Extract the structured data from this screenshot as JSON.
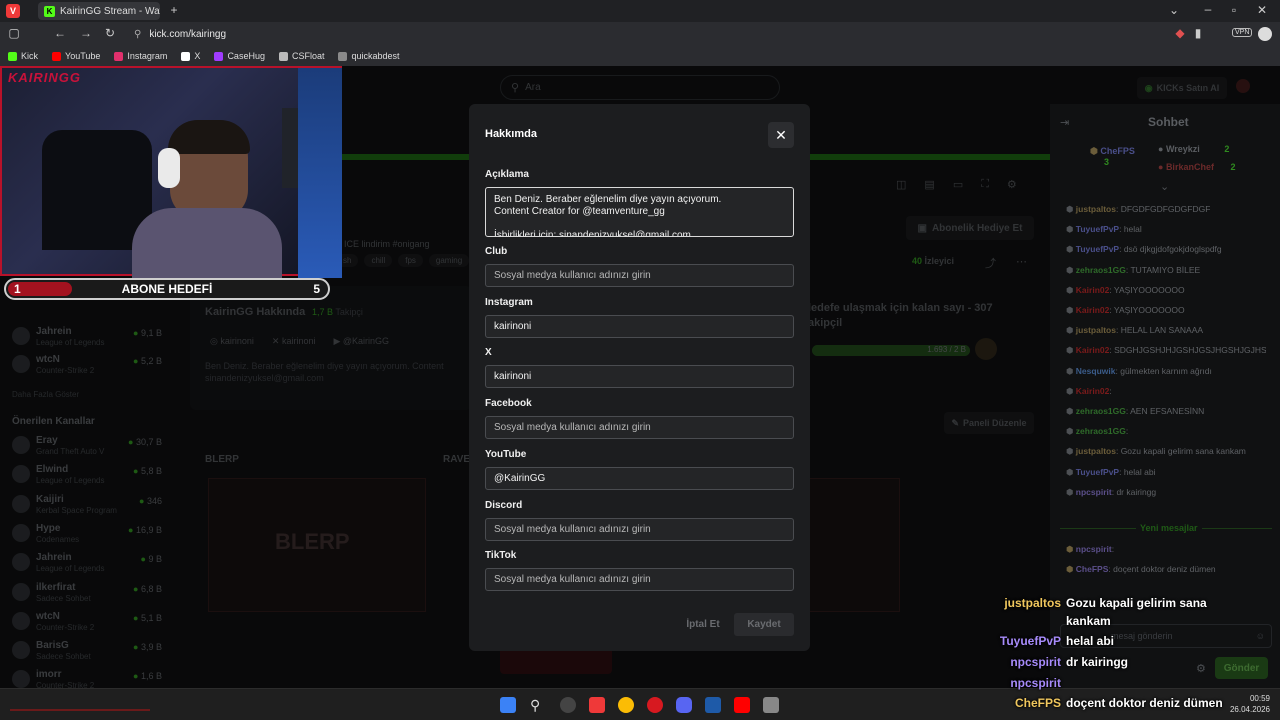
{
  "browser": {
    "tab_title": "KairinGG Stream - Watch Li",
    "url": "kick.com/kairingg",
    "bookmarks": [
      {
        "label": "Kick",
        "color": "#53fc18"
      },
      {
        "label": "YouTube",
        "color": "#ff0000"
      },
      {
        "label": "Instagram",
        "color": "#e1306c"
      },
      {
        "label": "X",
        "color": "#ffffff"
      },
      {
        "label": "CaseHug",
        "color": "#a03cff"
      },
      {
        "label": "CSFloat",
        "color": "#bbbbbb"
      },
      {
        "label": "quickabdest",
        "color": "#8a8a8a"
      }
    ]
  },
  "header": {
    "search_placeholder": "Ara",
    "buy_kicks": "KICKs Satın Al"
  },
  "stream": {
    "title_snippet": "ICE lindirim #onigang",
    "tags": [
      "sh",
      "chill",
      "fps",
      "gaming"
    ],
    "gift_sub_button": "Abonelik Hediye Et",
    "viewers": "40",
    "viewers_label": "İzleyici",
    "goal_text": "ledefe ulaşmak için kalan sayı - 307",
    "goal_text2": "akipçil",
    "goal_progress": "1.693 / 2 B",
    "about_title": "KairinGG Hakkında",
    "followers": "1,7 B",
    "followers_label": "Takipçi",
    "social_ig": "kairinoni",
    "social_x": "kairinoni",
    "social_yt": "@KairinGG",
    "bio_line1": "Ben Deniz. Beraber eğlenelim diye yayın açıyorum. Content",
    "bio_line2": "sinandenizyuksel@gmail.com",
    "edit_panel": "Paneli Düzenle",
    "panel_left": "BLERP",
    "panel_mid": "RAVE"
  },
  "sidebar": {
    "followed": [
      {
        "name": "Jahrein",
        "sub": "League of Legends",
        "val": "9,1 B"
      },
      {
        "name": "wtcN",
        "sub": "Counter-Strike 2",
        "val": "5,2 B"
      }
    ],
    "show_more": "Daha Fazla Göster",
    "recommended_title": "Önerilen Kanallar",
    "recommended": [
      {
        "name": "Eray",
        "sub": "Grand Theft Auto V",
        "val": "30,7 B"
      },
      {
        "name": "Elwind",
        "sub": "League of Legends",
        "val": "5,8 B"
      },
      {
        "name": "Kaijiri",
        "sub": "Kerbal Space Program",
        "val": "346"
      },
      {
        "name": "Hype",
        "sub": "Codenames",
        "val": "16,9 B"
      },
      {
        "name": "Jahrein",
        "sub": "League of Legends",
        "val": "9 B"
      },
      {
        "name": "ilkerfirat",
        "sub": "Sadece Sohbet",
        "val": "6,8 B"
      },
      {
        "name": "wtcN",
        "sub": "Counter-Strike 2",
        "val": "5,1 B"
      },
      {
        "name": "BarisG",
        "sub": "Sadece Sohbet",
        "val": "3,9 B"
      },
      {
        "name": "imorr",
        "sub": "Counter-Strike 2",
        "val": "1,6 B"
      }
    ]
  },
  "overlay": {
    "logo": "KAIRINGG",
    "sub_goal_label": "ABONE HEDEFİ",
    "sub_goal_current": "1",
    "sub_goal_target": "5",
    "sub_goal_fraction": 0.2
  },
  "modal": {
    "title": "Hakkımda",
    "description_label": "Açıklama",
    "description_value": "Ben Deniz. Beraber eğlenelim diye yayın açıyorum.\nContent Creator for @teamventure_gg\n\nİşbirlikleri için: sinandenizyuksel@gmail.com",
    "fields": [
      {
        "label": "Club",
        "value": "",
        "placeholder": "Sosyal medya kullanıcı adınızı girin"
      },
      {
        "label": "Instagram",
        "value": "kairinoni",
        "placeholder": ""
      },
      {
        "label": "X",
        "value": "kairinoni",
        "placeholder": ""
      },
      {
        "label": "Facebook",
        "value": "",
        "placeholder": "Sosyal medya kullanıcı adınızı girin"
      },
      {
        "label": "YouTube",
        "value": "@KairinGG",
        "placeholder": ""
      },
      {
        "label": "Discord",
        "value": "",
        "placeholder": "Sosyal medya kullanıcı adınızı girin"
      },
      {
        "label": "TikTok",
        "value": "",
        "placeholder": "Sosyal medya kullanıcı adınızı girin"
      }
    ],
    "cancel_label": "İptal Et",
    "save_label": "Kaydet"
  },
  "chat": {
    "title": "Sohbet",
    "top1": "CheFPS",
    "top1_val": "3",
    "top2": "Wreykzi",
    "top2_val": "2",
    "top3": "BirkanChef",
    "top3_val": "2",
    "messages": [
      {
        "user": "justpaltos",
        "text": "DFGDFGDFGDGFDGF",
        "color": "#6b5d3a"
      },
      {
        "user": "TuyuefPvP",
        "text": "helal",
        "color": "#4a4f8a"
      },
      {
        "user": "TuyuefPvP",
        "text": "dsö djkgjdofgokjdoglspdfg",
        "color": "#4a4f8a"
      },
      {
        "user": "zehraos1GG",
        "text": "TUTAMIYO BİLEE",
        "color": "#2f6b2a"
      },
      {
        "user": "Kairin02",
        "text": "YAŞIYOOOOOOO",
        "color": "#7a1b1b"
      },
      {
        "user": "Kairin02",
        "text": "YAŞIYOOOOOOO",
        "color": "#7a1b1b"
      },
      {
        "user": "justpaltos",
        "text": "HELAL LAN SANAAA",
        "color": "#6b5d3a"
      },
      {
        "user": "Kairin02",
        "text": "SDGHJGSHJHJGSHJGSJHGSHJGJHSJHGS",
        "color": "#7a1b1b"
      },
      {
        "user": "Nesquwik",
        "text": "gülmekten karnım ağrıdı",
        "color": "#3b5c8a"
      },
      {
        "user": "Kairin02",
        "text": "",
        "color": "#7a1b1b"
      },
      {
        "user": "zehraos1GG",
        "text": "AEN EFSANESİNN",
        "color": "#2f6b2a"
      },
      {
        "user": "zehraos1GG",
        "text": "",
        "color": "#2f6b2a"
      },
      {
        "user": "justpaltos",
        "text": "Gozu kapali gelirim sana kankam",
        "color": "#6b5d3a"
      },
      {
        "user": "TuyuefPvP",
        "text": "helal abi",
        "color": "#4a4f8a"
      },
      {
        "user": "npcspirit",
        "text": "dr kairingg",
        "color": "#5b4f8a"
      }
    ],
    "new_messages": "Yeni mesajlar",
    "after": [
      {
        "user": "npcspirit",
        "text": "",
        "color": "#5b4f8a"
      },
      {
        "user": "CheFPS",
        "text": "doçent doktor deniz dümen",
        "color": "#5b4f8a"
      }
    ],
    "input_placeholder": "mesaj gönderin",
    "send_label": "Gönder"
  },
  "stream_chat_overlay": [
    {
      "user": "justpaltos",
      "text": "Gozu kapali gelirim sana",
      "color": "#f0c75e"
    },
    {
      "user": "",
      "text": "kankam",
      "color": "#f0c75e"
    },
    {
      "user": "TuyuefPvP",
      "text": "helal abi",
      "color": "#a78bfa"
    },
    {
      "user": "npcspirit",
      "text": "dr kairingg",
      "color": "#a78bfa"
    },
    {
      "user": "npcspirit",
      "text": "",
      "color": "#a78bfa"
    },
    {
      "user": "CheFPS",
      "text": "doçent doktor deniz dümen",
      "color": "#f0c75e"
    }
  ],
  "taskbar": {
    "time": "00:59",
    "date": "26.04.2026"
  }
}
